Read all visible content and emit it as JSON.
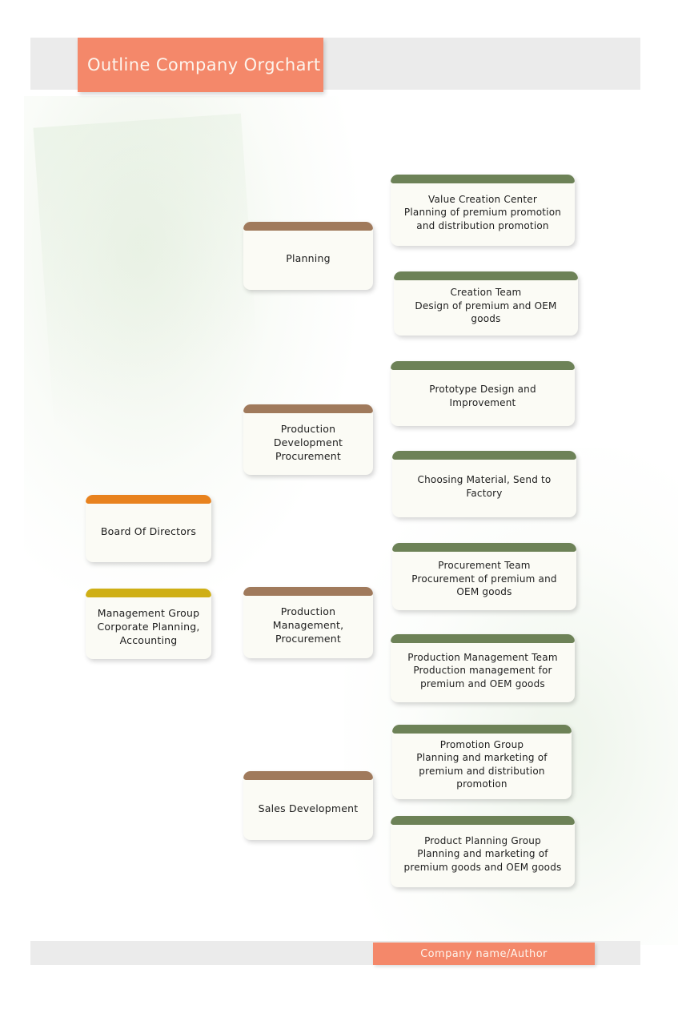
{
  "page": {
    "title": "Outline Company Orgchart",
    "footer": "Company name/Author"
  },
  "colors": {
    "title_plate": "#F4886A",
    "band": "#EBEBEB",
    "board": "#E8821E",
    "management": "#CFAF15",
    "division": "#A07A5C",
    "team": "#6D8257",
    "node_fill": "#FBFBF5",
    "text": "#1D1D1D"
  },
  "chart_data": {
    "type": "diagram",
    "title": "Outline Company Orgchart",
    "nodes": [
      {
        "id": "board",
        "label": "Board Of Directors",
        "level": 1,
        "cap": "#E8821E"
      },
      {
        "id": "management",
        "label": "Management Group\nCorporate Planning,\nAccounting",
        "level": 1,
        "cap": "#CFAF15"
      },
      {
        "id": "planning",
        "label": "Planning",
        "level": 2,
        "cap": "#A07A5C"
      },
      {
        "id": "proddev",
        "label": "Production\nDevelopment\nProcurement",
        "level": 2,
        "cap": "#A07A5C"
      },
      {
        "id": "prodmgmt",
        "label": "Production\nManagement,\nProcurement",
        "level": 2,
        "cap": "#A07A5C"
      },
      {
        "id": "salesdev",
        "label": "Sales Development",
        "level": 2,
        "cap": "#A07A5C"
      },
      {
        "id": "vcc",
        "label": "Value Creation Center\nPlanning of premium promotion\nand distribution promotion",
        "level": 3,
        "cap": "#6D8257"
      },
      {
        "id": "creation",
        "label": "Creation Team\nDesign of premium and OEM\ngoods",
        "level": 3,
        "cap": "#6D8257"
      },
      {
        "id": "prototype",
        "label": "Prototype Design and\nImprovement",
        "level": 3,
        "cap": "#6D8257"
      },
      {
        "id": "material",
        "label": "Choosing Material, Send to\nFactory",
        "level": 3,
        "cap": "#6D8257"
      },
      {
        "id": "procteam",
        "label": "Procurement Team\nProcurement of premium and\nOEM goods",
        "level": 3,
        "cap": "#6D8257"
      },
      {
        "id": "pmteam",
        "label": "Production Management  Team\nProduction management for\npremium and OEM goods",
        "level": 3,
        "cap": "#6D8257"
      },
      {
        "id": "promotion",
        "label": "Promotion Group\nPlanning and marketing of\npremium and distribution\npromotion",
        "level": 3,
        "cap": "#6D8257"
      },
      {
        "id": "productplan",
        "label": "Product Planning Group\nPlanning and marketing of\npremium goods and OEM goods",
        "level": 3,
        "cap": "#6D8257"
      }
    ]
  }
}
